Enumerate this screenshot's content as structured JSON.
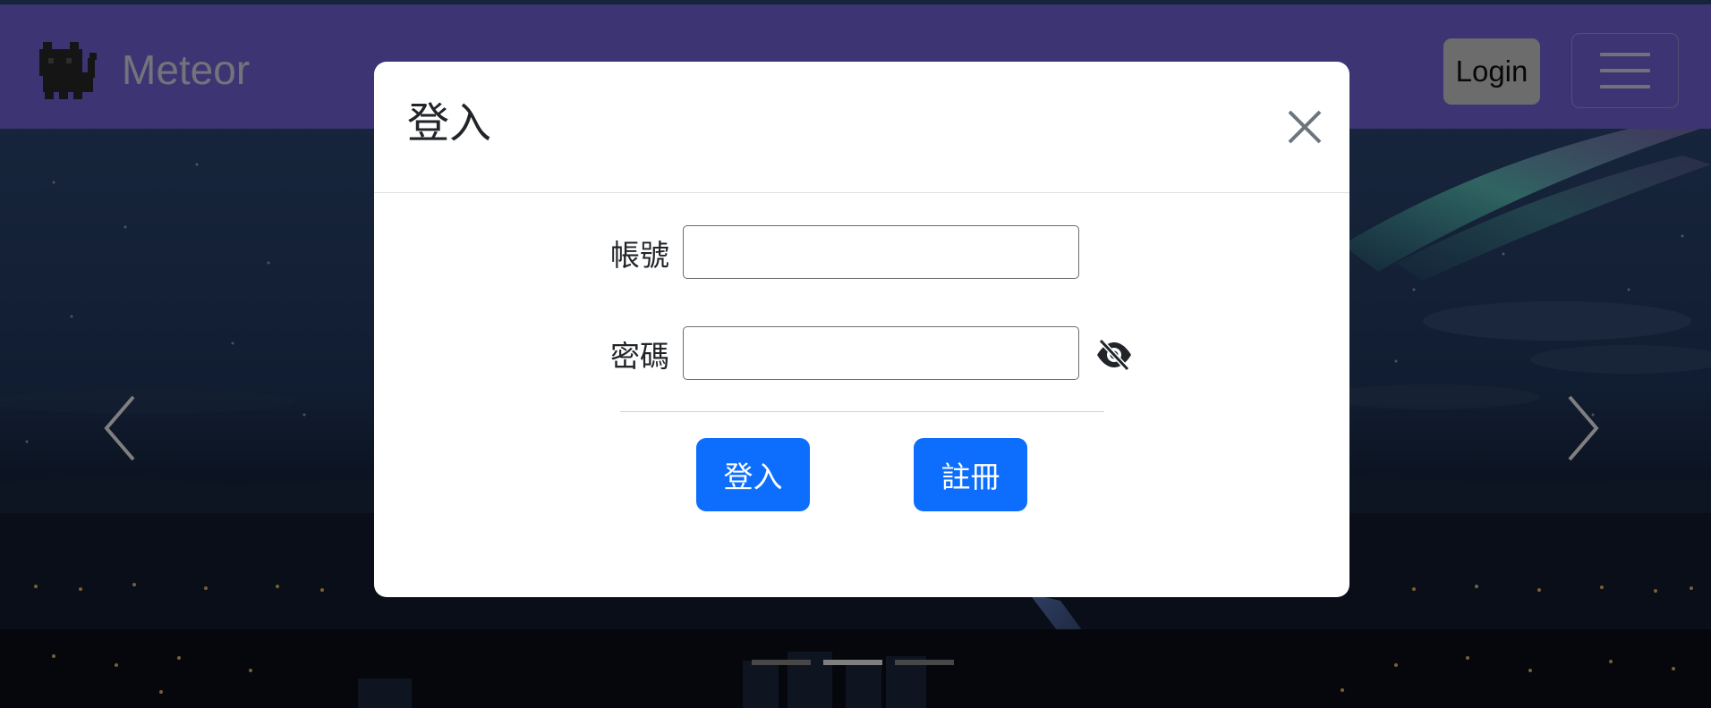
{
  "navbar": {
    "brand_name": "Meteor",
    "brand_logo_icon": "black-cat-icon",
    "login_label": "Login",
    "menu_icon": "hamburger-menu-icon",
    "color": "#7a69e6"
  },
  "carousel": {
    "prev_icon": "chevron-left-icon",
    "next_icon": "chevron-right-icon",
    "slide_count": 3,
    "active_slide": 2
  },
  "modal": {
    "title": "登入",
    "close_icon": "close-icon",
    "username": {
      "label": "帳號",
      "value": ""
    },
    "password": {
      "label": "密碼",
      "value": "",
      "toggle_icon": "eye-slash-icon"
    },
    "buttons": {
      "login_label": "登入",
      "register_label": "註冊"
    },
    "button_color": "#0d6efd"
  }
}
